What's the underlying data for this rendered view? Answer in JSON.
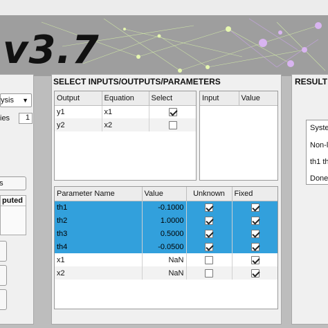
{
  "banner": {
    "title": "v3.7"
  },
  "left": {
    "dropdown_value": "ysis",
    "count_label": "ies",
    "count_value": "1",
    "button_label": "'s",
    "box_header": "puted"
  },
  "middle": {
    "title": "SELECT INPUTS/OUTPUTS/PARAMETERS",
    "outputs": {
      "headers": [
        "Output",
        "Equation",
        "Select"
      ],
      "rows": [
        {
          "output": "y1",
          "equation": "x1",
          "select": true
        },
        {
          "output": "y2",
          "equation": "x2",
          "select": false
        }
      ]
    },
    "inputs": {
      "headers": [
        "Input",
        "Value"
      ]
    },
    "parameters": {
      "headers": [
        "Parameter Name",
        "Value",
        "Unknown",
        "Fixed"
      ],
      "rows": [
        {
          "name": "th1",
          "value": "-0.1000",
          "unknown": true,
          "fixed": true,
          "selected": true
        },
        {
          "name": "th2",
          "value": "1.0000",
          "unknown": true,
          "fixed": true,
          "selected": true
        },
        {
          "name": "th3",
          "value": "0.5000",
          "unknown": true,
          "fixed": true,
          "selected": true
        },
        {
          "name": "th4",
          "value": "-0.0500",
          "unknown": true,
          "fixed": true,
          "selected": true
        },
        {
          "name": "x1",
          "value": "NaN",
          "unknown": false,
          "fixed": true,
          "selected": false
        },
        {
          "name": "x2",
          "value": "NaN",
          "unknown": false,
          "fixed": true,
          "selected": false
        }
      ]
    }
  },
  "right": {
    "title": "RESULT",
    "lines": [
      "Syste",
      "Non-l",
      "th1 th",
      "Done"
    ]
  },
  "colors": {
    "selected_row": "#32a0dc",
    "banner": "#9e9e9e",
    "panel": "#f0f0f0"
  }
}
